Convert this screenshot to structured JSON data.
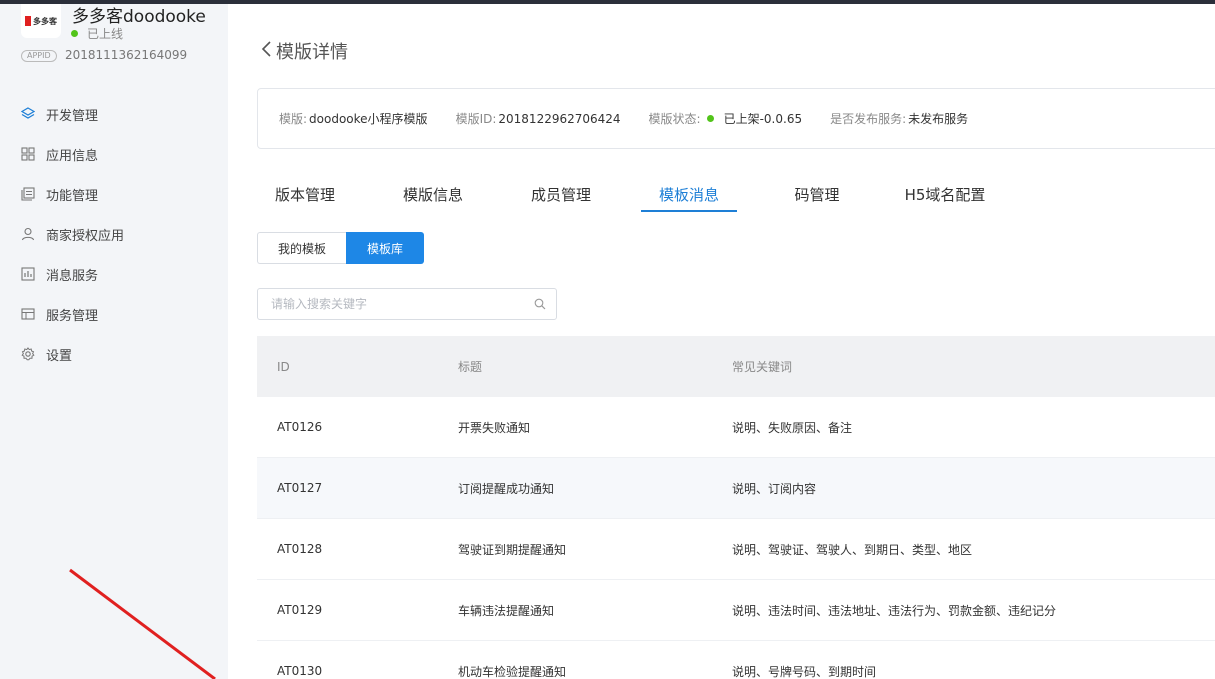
{
  "app": {
    "name": "多多客doodooke",
    "logo_text": "多多客",
    "status": "已上线",
    "appid_label": "APPID",
    "appid": "2018111362164099"
  },
  "sidebar": {
    "items": [
      {
        "label": "开发管理",
        "icon": "layers-icon"
      },
      {
        "label": "应用信息",
        "icon": "grid-icon"
      },
      {
        "label": "功能管理",
        "icon": "document-icon"
      },
      {
        "label": "商家授权应用",
        "icon": "user-icon"
      },
      {
        "label": "消息服务",
        "icon": "chart-icon"
      },
      {
        "label": "服务管理",
        "icon": "table-icon"
      },
      {
        "label": "设置",
        "icon": "gear-icon"
      }
    ],
    "active_index": 0
  },
  "page": {
    "title": "模版详情"
  },
  "info": {
    "template_label": "模版:",
    "template_value": "doodooke小程序模版",
    "id_label": "模版ID:",
    "id_value": "2018122962706424",
    "status_label": "模版状态:",
    "status_value": "已上架-0.0.65",
    "publish_label": "是否发布服务:",
    "publish_value": "未发布服务"
  },
  "tabs": [
    {
      "label": "版本管理"
    },
    {
      "label": "模版信息"
    },
    {
      "label": "成员管理"
    },
    {
      "label": "模板消息"
    },
    {
      "label": "码管理"
    },
    {
      "label": "H5域名配置"
    }
  ],
  "active_tab": 3,
  "segmented": {
    "my_templates": "我的模板",
    "library": "模板库"
  },
  "search": {
    "placeholder": "请输入搜索关键字"
  },
  "table": {
    "headers": [
      "ID",
      "标题",
      "常见关键词"
    ],
    "rows": [
      [
        "AT0126",
        "开票失败通知",
        "说明、失败原因、备注"
      ],
      [
        "AT0127",
        "订阅提醒成功通知",
        "说明、订阅内容"
      ],
      [
        "AT0128",
        "驾驶证到期提醒通知",
        "说明、驾驶证、驾驶人、到期日、类型、地区"
      ],
      [
        "AT0129",
        "车辆违法提醒通知",
        "说明、违法时间、违法地址、违法行为、罚款金额、违纪记分"
      ],
      [
        "AT0130",
        "机动车检验提醒通知",
        "说明、号牌号码、到期时间"
      ]
    ]
  },
  "colors": {
    "accent": "#1e7fd6",
    "online": "#52c41a",
    "annotation": "#e02020"
  }
}
